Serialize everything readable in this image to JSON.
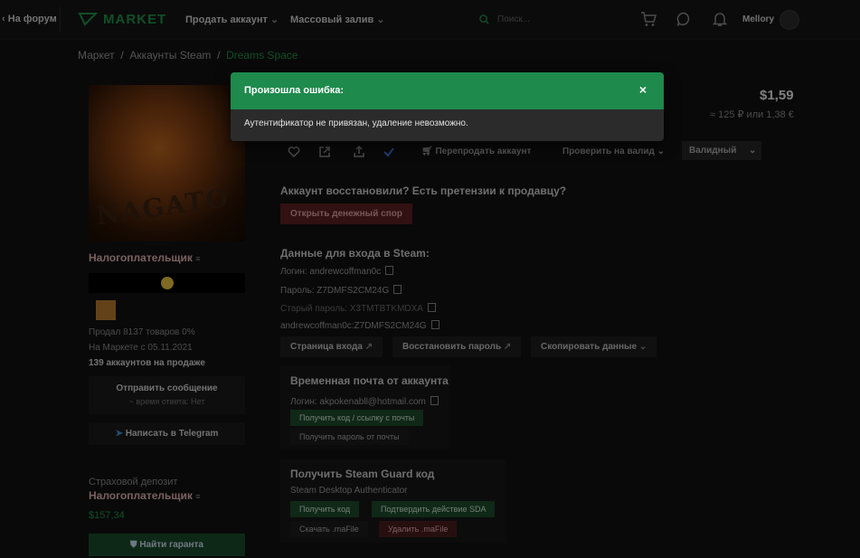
{
  "header": {
    "back_label": "На форум",
    "logo": "MARKET",
    "nav": [
      "Продать аккаунт",
      "Массовый залив"
    ],
    "search_placeholder": "Поиск...",
    "username": "Mellory"
  },
  "breadcrumb": [
    "Маркет",
    "Аккаунты Steam",
    "Dreams Space"
  ],
  "seller": {
    "name": "Налогоплательщик",
    "stats": [
      "Продал 8137 товаров 0%",
      "На Маркете с 05.11.2021"
    ],
    "on_sale": "139 аккаунтов на продаже",
    "message_btn": "Отправить сообщение",
    "response_time": "~ время ответа: Нет",
    "telegram_btn": "Написать в Telegram",
    "deposit_label": "Страховой депозит",
    "deposit_name": "Налогоплательщик",
    "deposit_amount": "$157,34",
    "guarantor_btn": "Найти гаранта"
  },
  "price": {
    "main": "$1,59",
    "sub": "≈ 125 ₽ или 1,38 €"
  },
  "toolbar": {
    "resell": "Перепродать аккаунт",
    "check": "Проверить на валид",
    "valid": "Валидный"
  },
  "dispute": {
    "title": "Аккаунт восстановили? Есть претензии к продавцу?",
    "button": "Открыть денежный спор"
  },
  "login_data": {
    "title": "Данные для входа в Steam:",
    "login": "Логин: andrewcoffman0c",
    "password": "Пароль: Z7DMFS2CM24G",
    "old_password": "Старый пароль: X3TMTBTKMDXA",
    "combo": "andrewcoffman0c:Z7DMFS2CM24G",
    "btn_login_page": "Страница входа",
    "btn_restore": "Восстановить пароль",
    "btn_copy": "Скопировать данные"
  },
  "temp_mail": {
    "title": "Временная почта от аккаунта",
    "login": "Логин: akpokenabll@hotmail.com",
    "btn_get_code": "Получить код / ссылку с почты",
    "btn_get_password": "Получить пароль от почты"
  },
  "guard": {
    "title": "Получить Steam Guard код",
    "subtitle": "Steam Desktop Authenticator",
    "btn_get_code": "Получить код",
    "btn_confirm": "Подтвердить действие SDA",
    "btn_download": "Скачать .maFile",
    "btn_delete": "Удалить .maFile"
  },
  "modal": {
    "title": "Произошла ошибка:",
    "message": "Аутентификатор не привязан, удаление невозможно.",
    "close": "×"
  },
  "colors": {
    "accent": "#1e8a4c",
    "background": "#111111",
    "danger": "#5a1f1f"
  }
}
